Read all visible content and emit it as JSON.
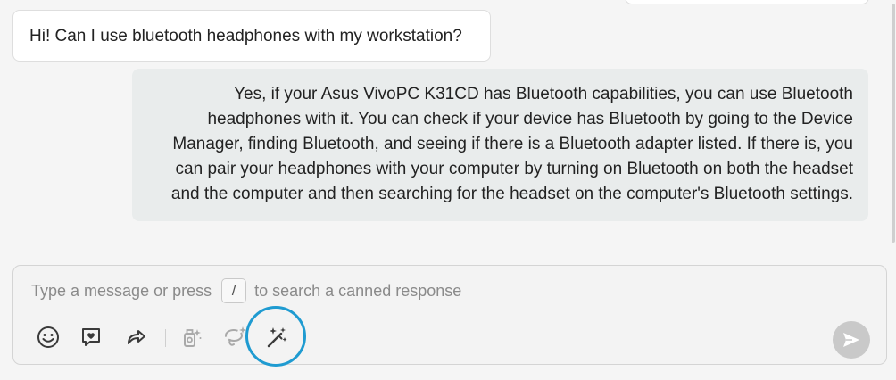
{
  "conversation": {
    "user_message": "Hi! Can I use bluetooth headphones with my workstation?",
    "agent_message_lines": [
      "Yes, if your Asus VivoPC K31CD has Bluetooth capabilities, you can use Bluetooth",
      "headphones with it. You can check if your device has Bluetooth by going to the Device",
      "Manager, finding Bluetooth, and seeing if there is a Bluetooth adapter listed. If there is, you",
      "can pair your headphones with your computer by turning on Bluetooth on both the headset",
      "and the computer and then searching for the headset on the computer's Bluetooth settings."
    ]
  },
  "composer": {
    "placeholder_prefix": "Type a message or press",
    "slash_key": "/",
    "placeholder_suffix": "to search a canned response",
    "toolbar": [
      {
        "icon": "smiley-icon"
      },
      {
        "icon": "heart-chat-icon"
      },
      {
        "icon": "share-arrow-icon"
      },
      {
        "icon": "sparkle-bottle-icon"
      },
      {
        "icon": "sparkle-lasso-icon"
      },
      {
        "icon": "magic-wand-icon"
      }
    ],
    "send_icon": "send-icon"
  },
  "colors": {
    "highlight_ring": "#1f9bd1",
    "agent_bubble": "#e9ecec",
    "user_bubble": "#ffffff",
    "send_button": "#c9c9c9"
  }
}
